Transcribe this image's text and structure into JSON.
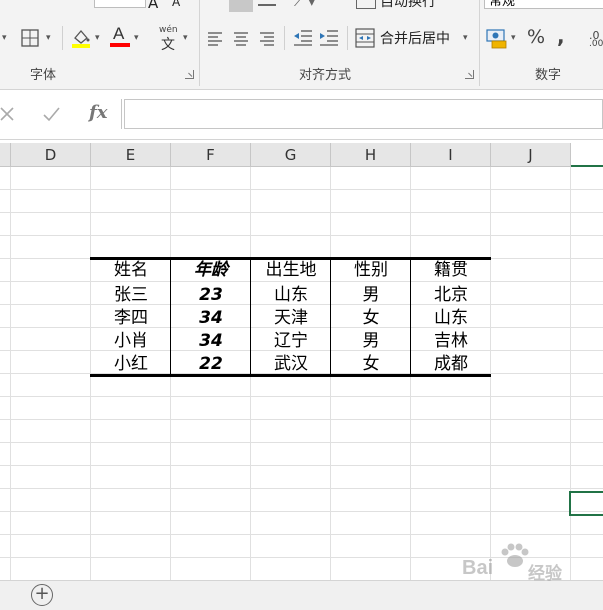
{
  "ribbon": {
    "font_group_label": "字体",
    "align_group_label": "对齐方式",
    "number_group_label": "数字",
    "wrap_text_label": "自动换行",
    "merge_center_label": "合并后居中",
    "number_format_value": "常规",
    "percent_symbol": "%",
    "comma_symbol": ",",
    "phonetic_label": "wén",
    "phonetic_char": "文",
    "font_color_letter": "A",
    "font_size_up": "A",
    "font_size_down": "A",
    "accent_color": "#217346",
    "fill_color": "#ffff00",
    "font_color": "#ff0000"
  },
  "formula_bar": {
    "fx_label": "fx",
    "value": ""
  },
  "columns": [
    "D",
    "E",
    "F",
    "G",
    "H",
    "I",
    "J"
  ],
  "table": {
    "headers": [
      "姓名",
      "年龄",
      "出生地",
      "性别",
      "籍贯"
    ],
    "rows": [
      [
        "张三",
        "23",
        "山东",
        "男",
        "北京"
      ],
      [
        "李四",
        "34",
        "天津",
        "女",
        "山东"
      ],
      [
        "小肖",
        "34",
        "辽宁",
        "男",
        "吉林"
      ],
      [
        "小红",
        "22",
        "武汉",
        "女",
        "成都"
      ]
    ]
  },
  "sheet_bar": {
    "add_sheet_symbol": "+"
  },
  "watermark": {
    "text": "Bai",
    "suffix": "经验"
  }
}
